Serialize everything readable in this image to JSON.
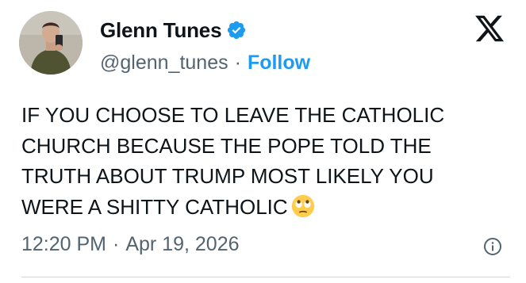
{
  "author": {
    "display_name": "Glenn Tunes",
    "handle": "@glenn_tunes",
    "separator": "·",
    "follow_label": "Follow",
    "verified": true,
    "verified_color": "#1d9bf0"
  },
  "tweet": {
    "text": "IF YOU CHOOSE TO LEAVE THE CATHOLIC\nCHURCH BECAUSE THE POPE TOLD THE\nTRUTH ABOUT TRUMP MOST LIKELY YOU\nWERE A SHITTY CATHOLIC",
    "emoji": "face-with-rolling-eyes-emoji"
  },
  "footer": {
    "time": "12:20 PM",
    "separator": "·",
    "date": "Apr 19, 2026"
  },
  "icons": {
    "brand": "x-logo-icon",
    "info": "info-icon",
    "verified": "verified-badge-icon"
  },
  "colors": {
    "text": "#0f1419",
    "secondary": "#536471",
    "accent": "#1d9bf0",
    "divider": "#cfd9de"
  }
}
